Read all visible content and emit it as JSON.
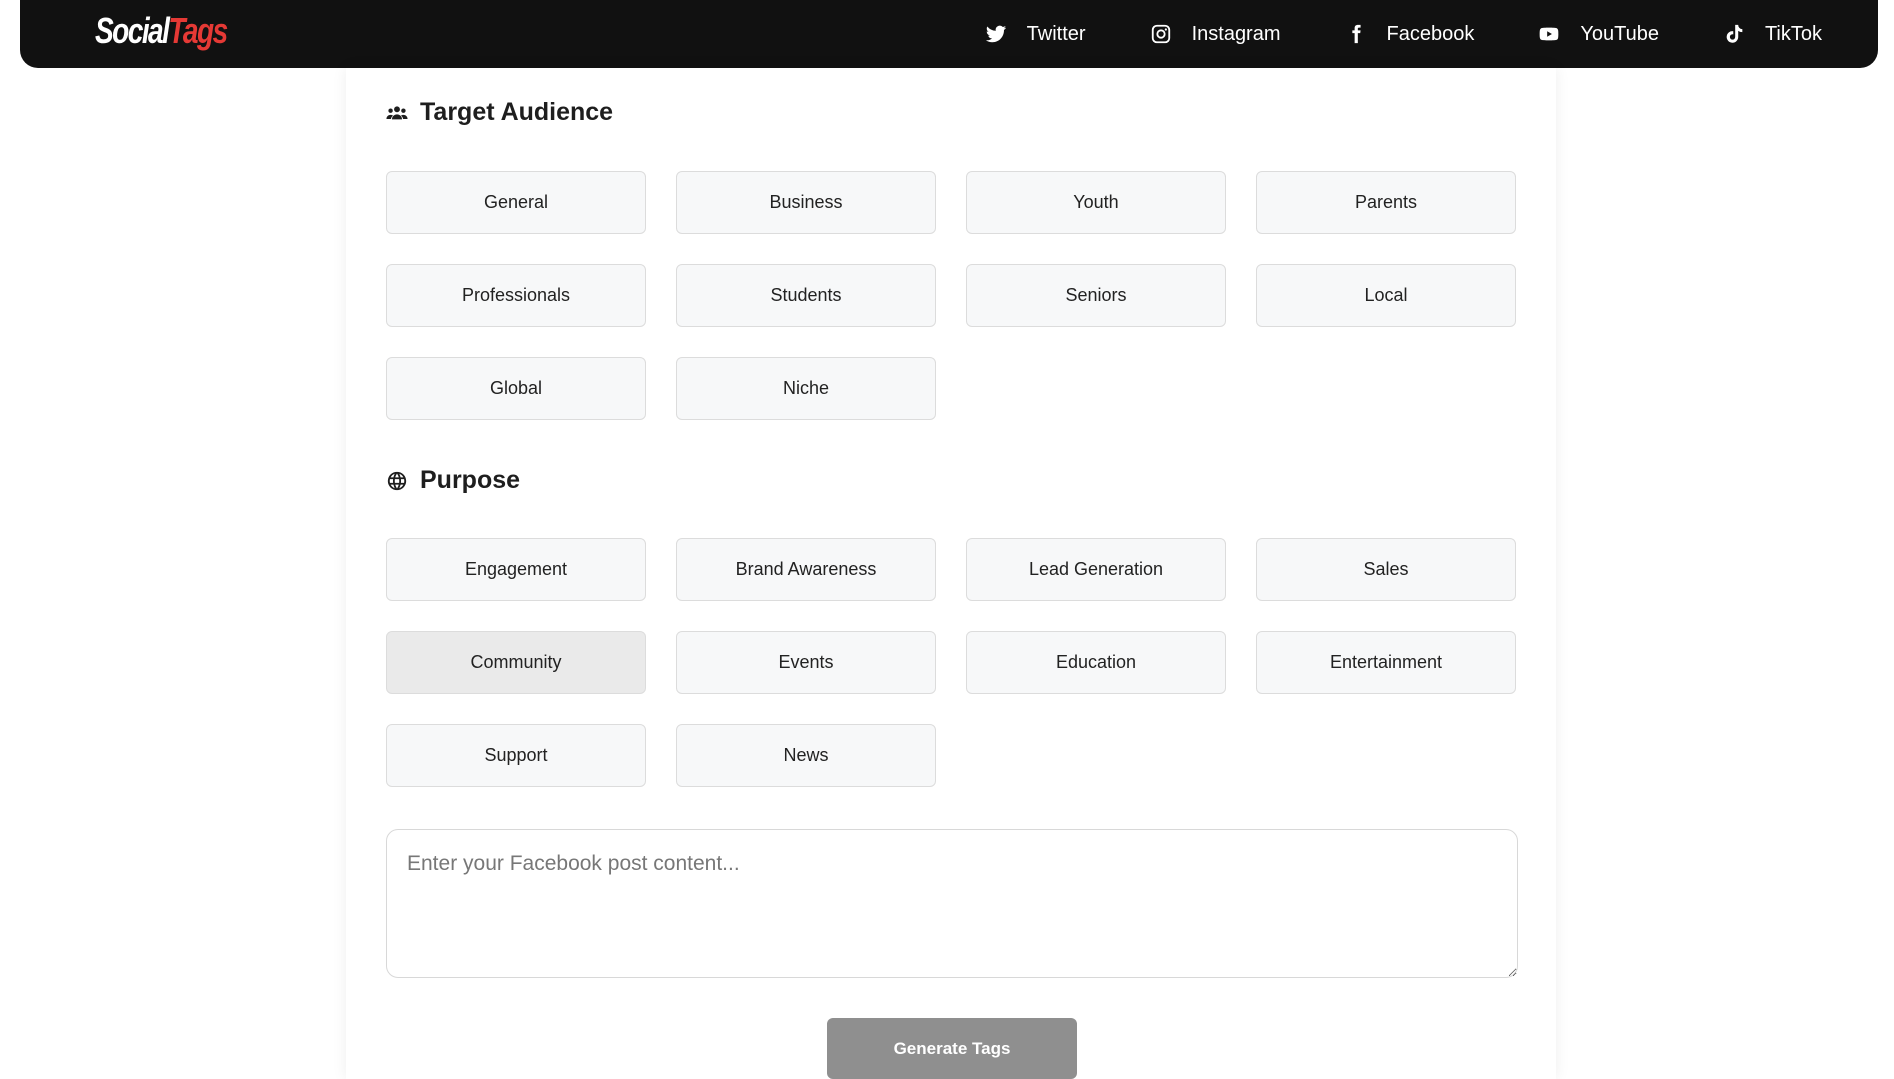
{
  "brand": {
    "part1": "Social",
    "part2": "Tags"
  },
  "nav": [
    {
      "label": "Twitter",
      "icon": "twitter-icon"
    },
    {
      "label": "Instagram",
      "icon": "instagram-icon"
    },
    {
      "label": "Facebook",
      "icon": "facebook-icon"
    },
    {
      "label": "YouTube",
      "icon": "youtube-icon"
    },
    {
      "label": "TikTok",
      "icon": "tiktok-icon"
    }
  ],
  "audience": {
    "title": "Target Audience",
    "icon": "users-icon",
    "options": [
      "General",
      "Business",
      "Youth",
      "Parents",
      "Professionals",
      "Students",
      "Seniors",
      "Local",
      "Global",
      "Niche"
    ]
  },
  "purpose": {
    "title": "Purpose",
    "icon": "globe-icon",
    "selected": "Community",
    "options": [
      "Engagement",
      "Brand Awareness",
      "Lead Generation",
      "Sales",
      "Community",
      "Events",
      "Education",
      "Entertainment",
      "Support",
      "News"
    ]
  },
  "post": {
    "placeholder": "Enter your Facebook post content...",
    "value": ""
  },
  "generate_label": "Generate Tags",
  "colors": {
    "navbar": "#111111",
    "brand_accent": "#e53935",
    "button_disabled": "#8f8f8f",
    "option_bg": "#f7f8f9",
    "option_selected_bg": "#eaeaea"
  }
}
